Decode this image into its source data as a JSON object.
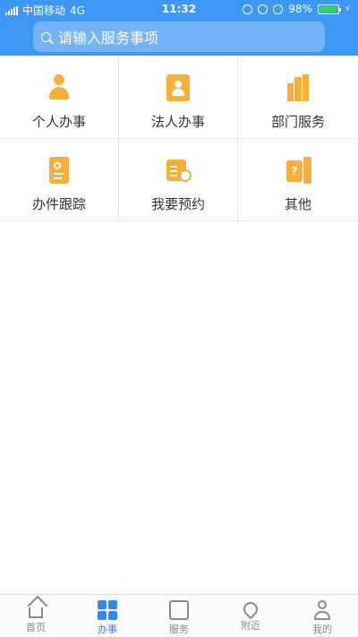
{
  "status_bar": {
    "carrier": "中国移动",
    "network": "4G",
    "time": "11:32",
    "battery": "98%"
  },
  "search": {
    "placeholder": "请输入服务事项"
  },
  "services": [
    {
      "label": "个人办事",
      "icon": "person-icon"
    },
    {
      "label": "法人办事",
      "icon": "legal-person-icon"
    },
    {
      "label": "部门服务",
      "icon": "building-icon"
    },
    {
      "label": "办件跟踪",
      "icon": "tracking-icon"
    },
    {
      "label": "我要预约",
      "icon": "calendar-icon"
    },
    {
      "label": "其他",
      "icon": "other-icon"
    }
  ],
  "tabbar": {
    "items": [
      {
        "label": "首页",
        "icon": "home-icon"
      },
      {
        "label": "办事",
        "icon": "apps-icon",
        "active": true
      },
      {
        "label": "服务",
        "icon": "service-icon"
      },
      {
        "label": "附近",
        "icon": "location-icon"
      },
      {
        "label": "我的",
        "icon": "user-icon"
      }
    ]
  },
  "colors": {
    "header": "#3d98f5",
    "icon_orange": "#f6b03a",
    "tab_active": "#2f8af0"
  }
}
